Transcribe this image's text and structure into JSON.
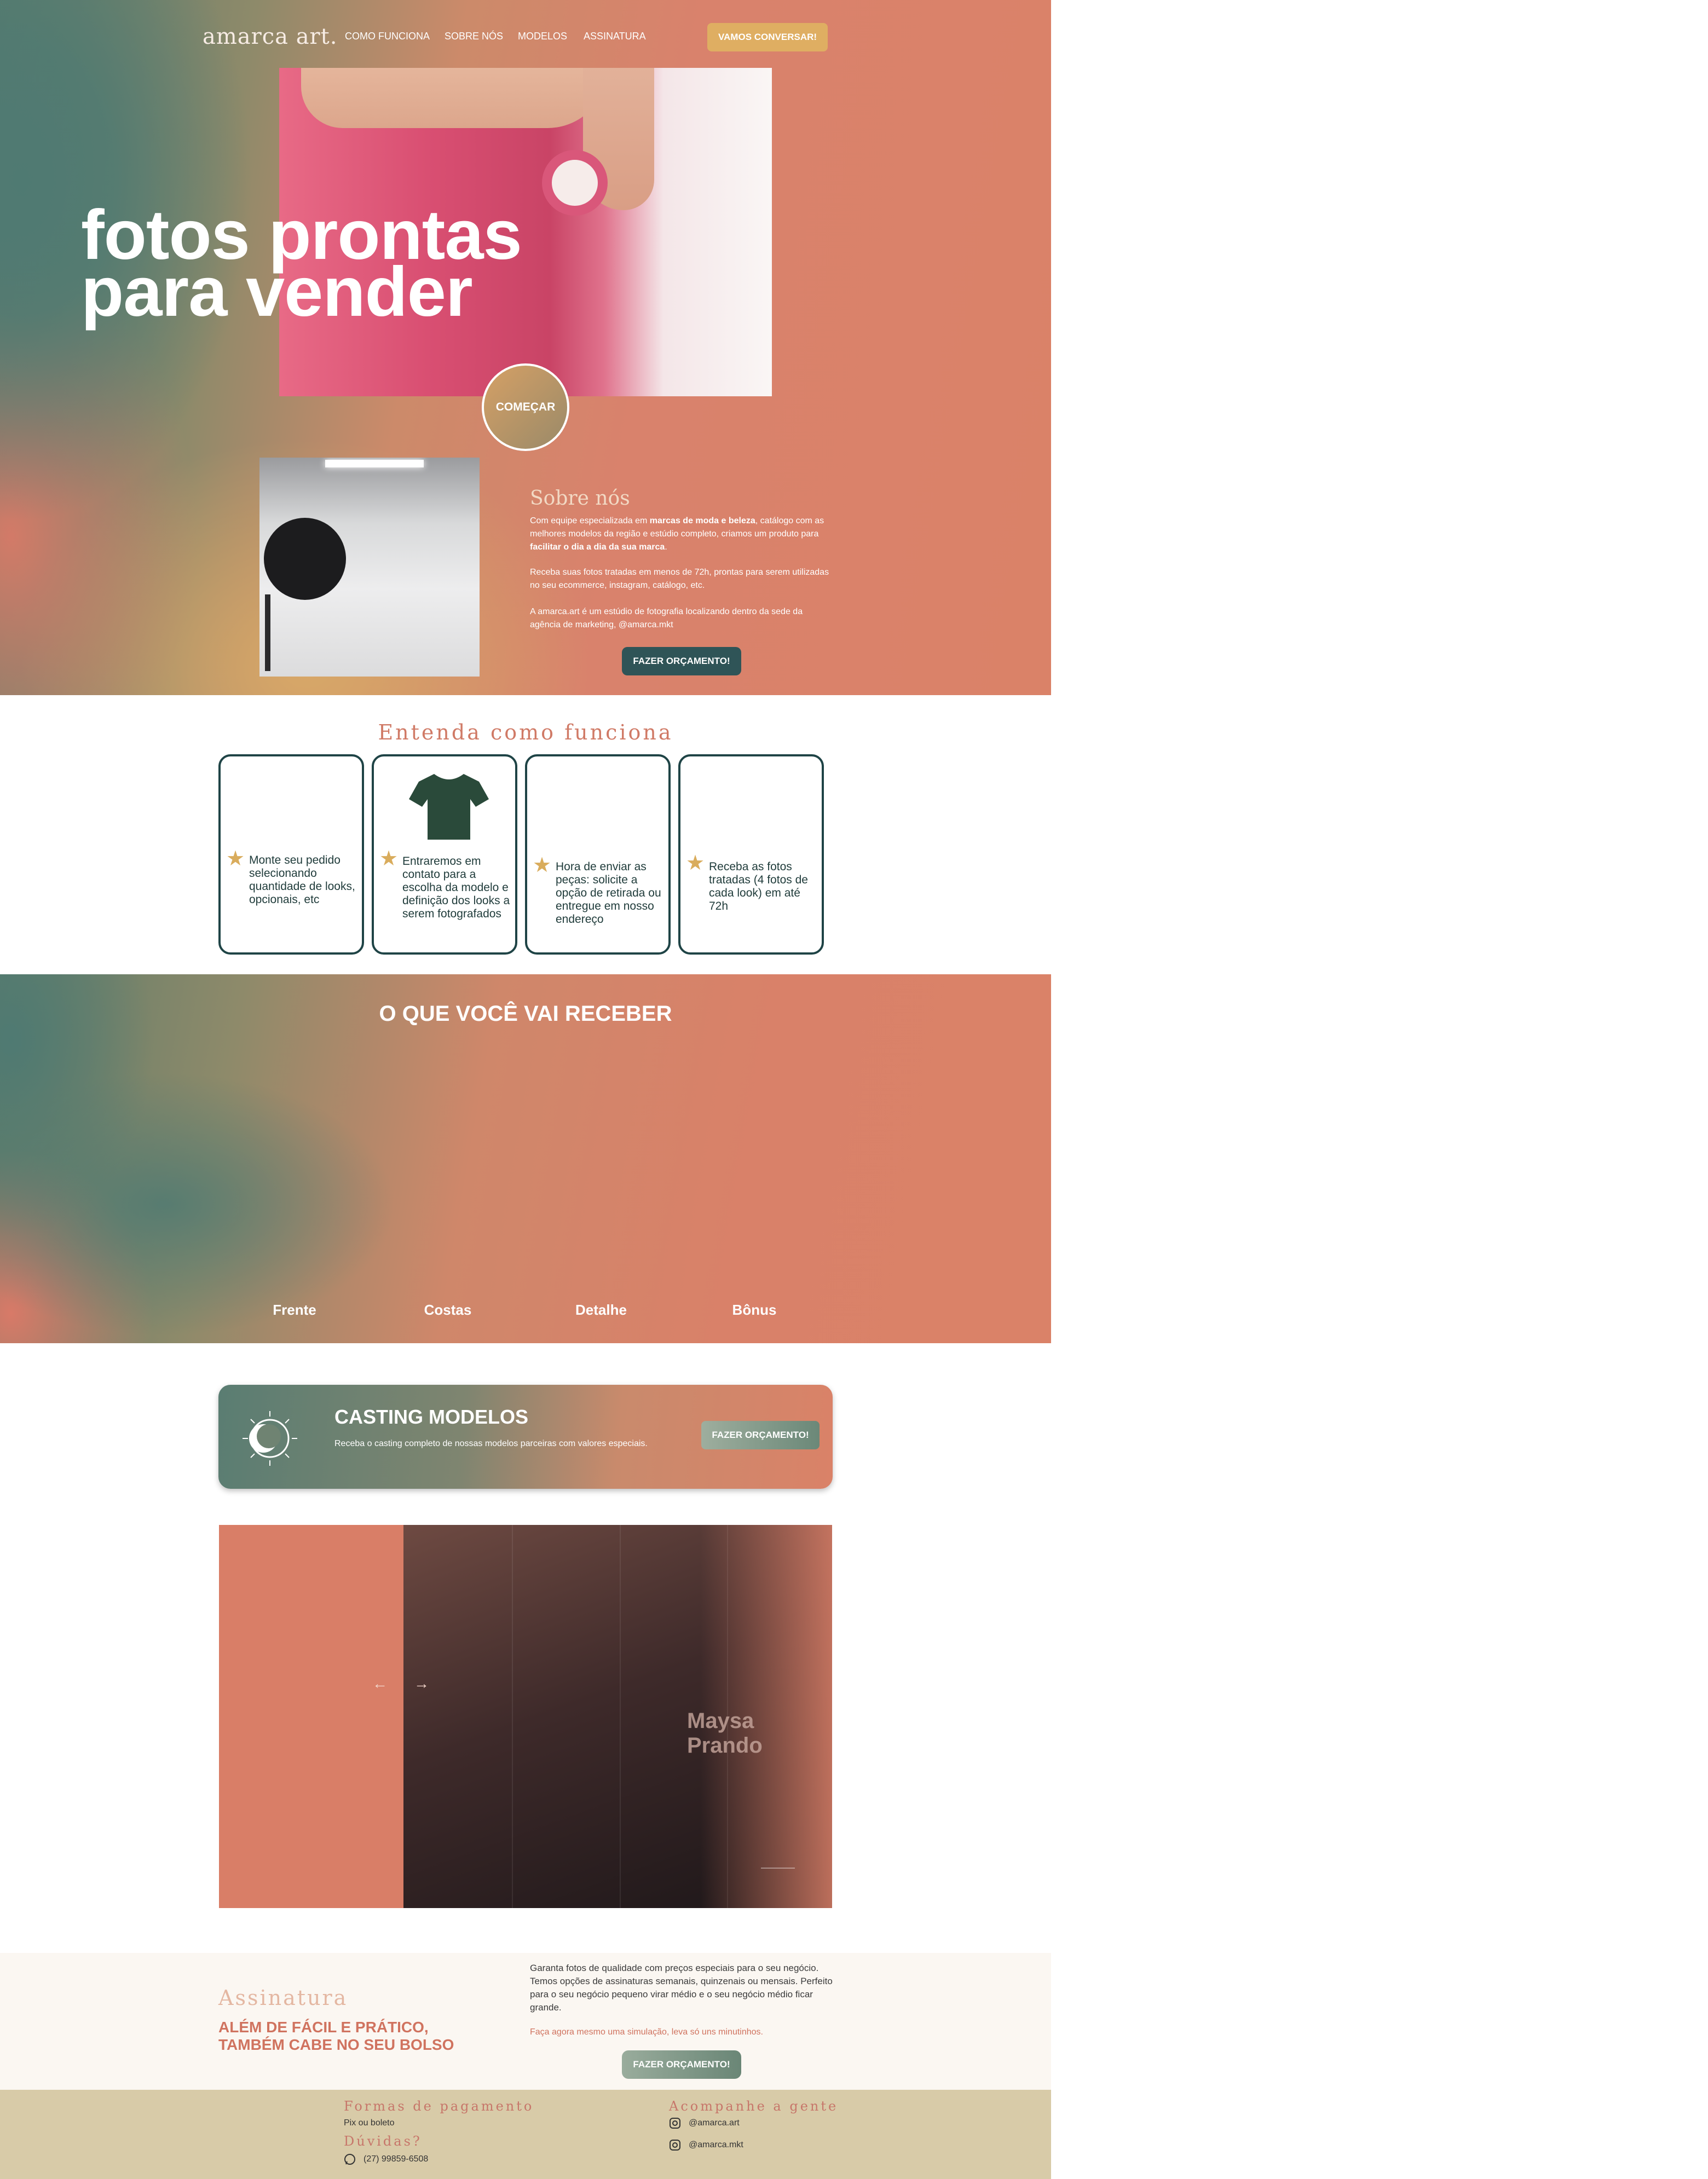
{
  "nav": {
    "logo": "amarca art.",
    "links": [
      "COMO FUNCIONA",
      "SOBRE NÓS",
      "MODELOS",
      "ASSINATURA"
    ],
    "cta": "VAMOS CONVERSAR!"
  },
  "hero": {
    "title_line1": "fotos prontas",
    "title_line2": "para vender",
    "button": "COMEÇAR"
  },
  "about": {
    "heading": "Sobre nós",
    "p1_a": "Com equipe especializada em ",
    "p1_b": "marcas de moda e beleza",
    "p1_c": ", catálogo com as melhores modelos da região e estúdio completo, criamos um produto para ",
    "p1_d": "facilitar o dia a dia da sua marca",
    "p1_e": ".",
    "p2": "Receba suas fotos tratadas em menos de 72h, prontas para serem utilizadas no seu ecommerce, instagram, catálogo, etc.",
    "p3": "A amarca.art é um estúdio de fotografia localizando dentro da sede da agência de marketing, @amarca.mkt",
    "button": "FAZER ORÇAMENTO!"
  },
  "how": {
    "heading": "Entenda como funciona",
    "steps": [
      "Monte seu pedido selecionando quantidade de looks, opcionais, etc",
      "Entraremos em contato para a escolha da modelo e definição dos looks a serem fotografados",
      "Hora de enviar as peças: solicite a opção de retirada ou entregue em nosso endereço",
      "Receba as fotos tratadas (4 fotos de cada look) em até 72h"
    ]
  },
  "receive": {
    "heading": "O QUE VOCÊ VAI RECEBER",
    "labels": [
      "Frente",
      "Costas",
      "Detalhe",
      "Bônus"
    ]
  },
  "casting": {
    "heading": "CASTING MODELOS",
    "text": "Receba o casting completo de nossas modelos parceiras com valores especiais.",
    "button": "FAZER ORÇAMENTO!"
  },
  "models": {
    "name": "Maysa Prando",
    "prev": "←",
    "next": "→"
  },
  "subscription": {
    "heading": "Assinatura",
    "tagline_1": "ALÉM DE FÁCIL E PRÁTICO,",
    "tagline_2": "TAMBÉM CABE NO SEU BOLSO",
    "text": "Garanta fotos de qualidade com preços especiais para o seu negócio. Temos opções de assinaturas semanais, quinzenais ou mensais. Perfeito para o seu negócio pequeno virar médio e o seu negócio médio ficar grande.",
    "note": "Faça agora mesmo uma simulação, leva só uns minutinhos.",
    "button": "FAZER ORÇAMENTO!"
  },
  "footer": {
    "payment_heading": "Formas de pagamento",
    "payment_text": "Pix ou boleto",
    "doubts_heading": "Dúvidas?",
    "phone": "(27) 99859-6508",
    "follow_heading": "Acompanhe a gente",
    "instagram_1": "@amarca.art",
    "instagram_2": "@amarca.mkt"
  }
}
